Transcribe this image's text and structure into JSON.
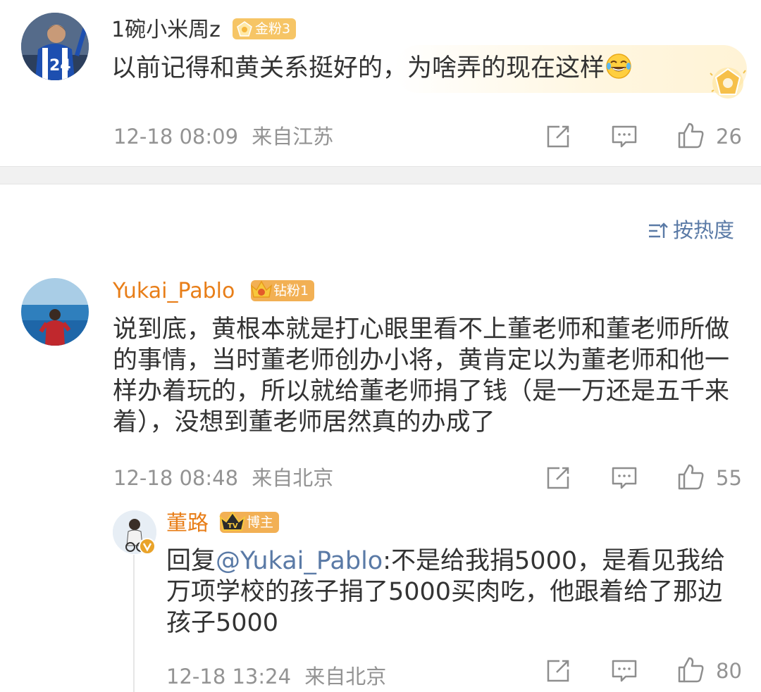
{
  "comments": [
    {
      "username": "1碗小米周z",
      "badge": "金粉3",
      "text": "以前记得和黄关系挺好的，为啥弄的现在这样",
      "emoji": "laughing-tears-emoji",
      "time": "12-18 08:09",
      "location": "来自江苏",
      "likes": "26"
    },
    {
      "username": "Yukai_Pablo",
      "badge": "钻粉1",
      "text": "说到底，黄根本就是打心眼里看不上董老师和董老师所做的事情，当时董老师创办小将，黄肯定以为董老师和他一样办着玩的，所以就给董老师捐了钱（是一万还是五千来着），没想到董老师居然真的办成了",
      "time": "12-18 08:48",
      "location": "来自北京",
      "likes": "55"
    }
  ],
  "reply": {
    "username": "董路",
    "badge": "博主",
    "prefix": "回复",
    "mention": "@Yukai_Pablo",
    "text": ":不是给我捐5000，是看见我给万项学校的孩子捐了5000买肉吃，他跟着给了那边孩子5000",
    "time": "12-18 13:24",
    "location": "来自北京",
    "likes": "80"
  },
  "sort_label": "按热度",
  "icons": [
    "share-icon",
    "comment-icon",
    "like-icon",
    "sort-icon",
    "gold-badge-icon",
    "crown-icon",
    "verified-icon"
  ],
  "colors": {
    "username_highlight": "#e87e18",
    "link": "#5a7aa6",
    "meta": "#939393",
    "badge": "#f2b054"
  }
}
